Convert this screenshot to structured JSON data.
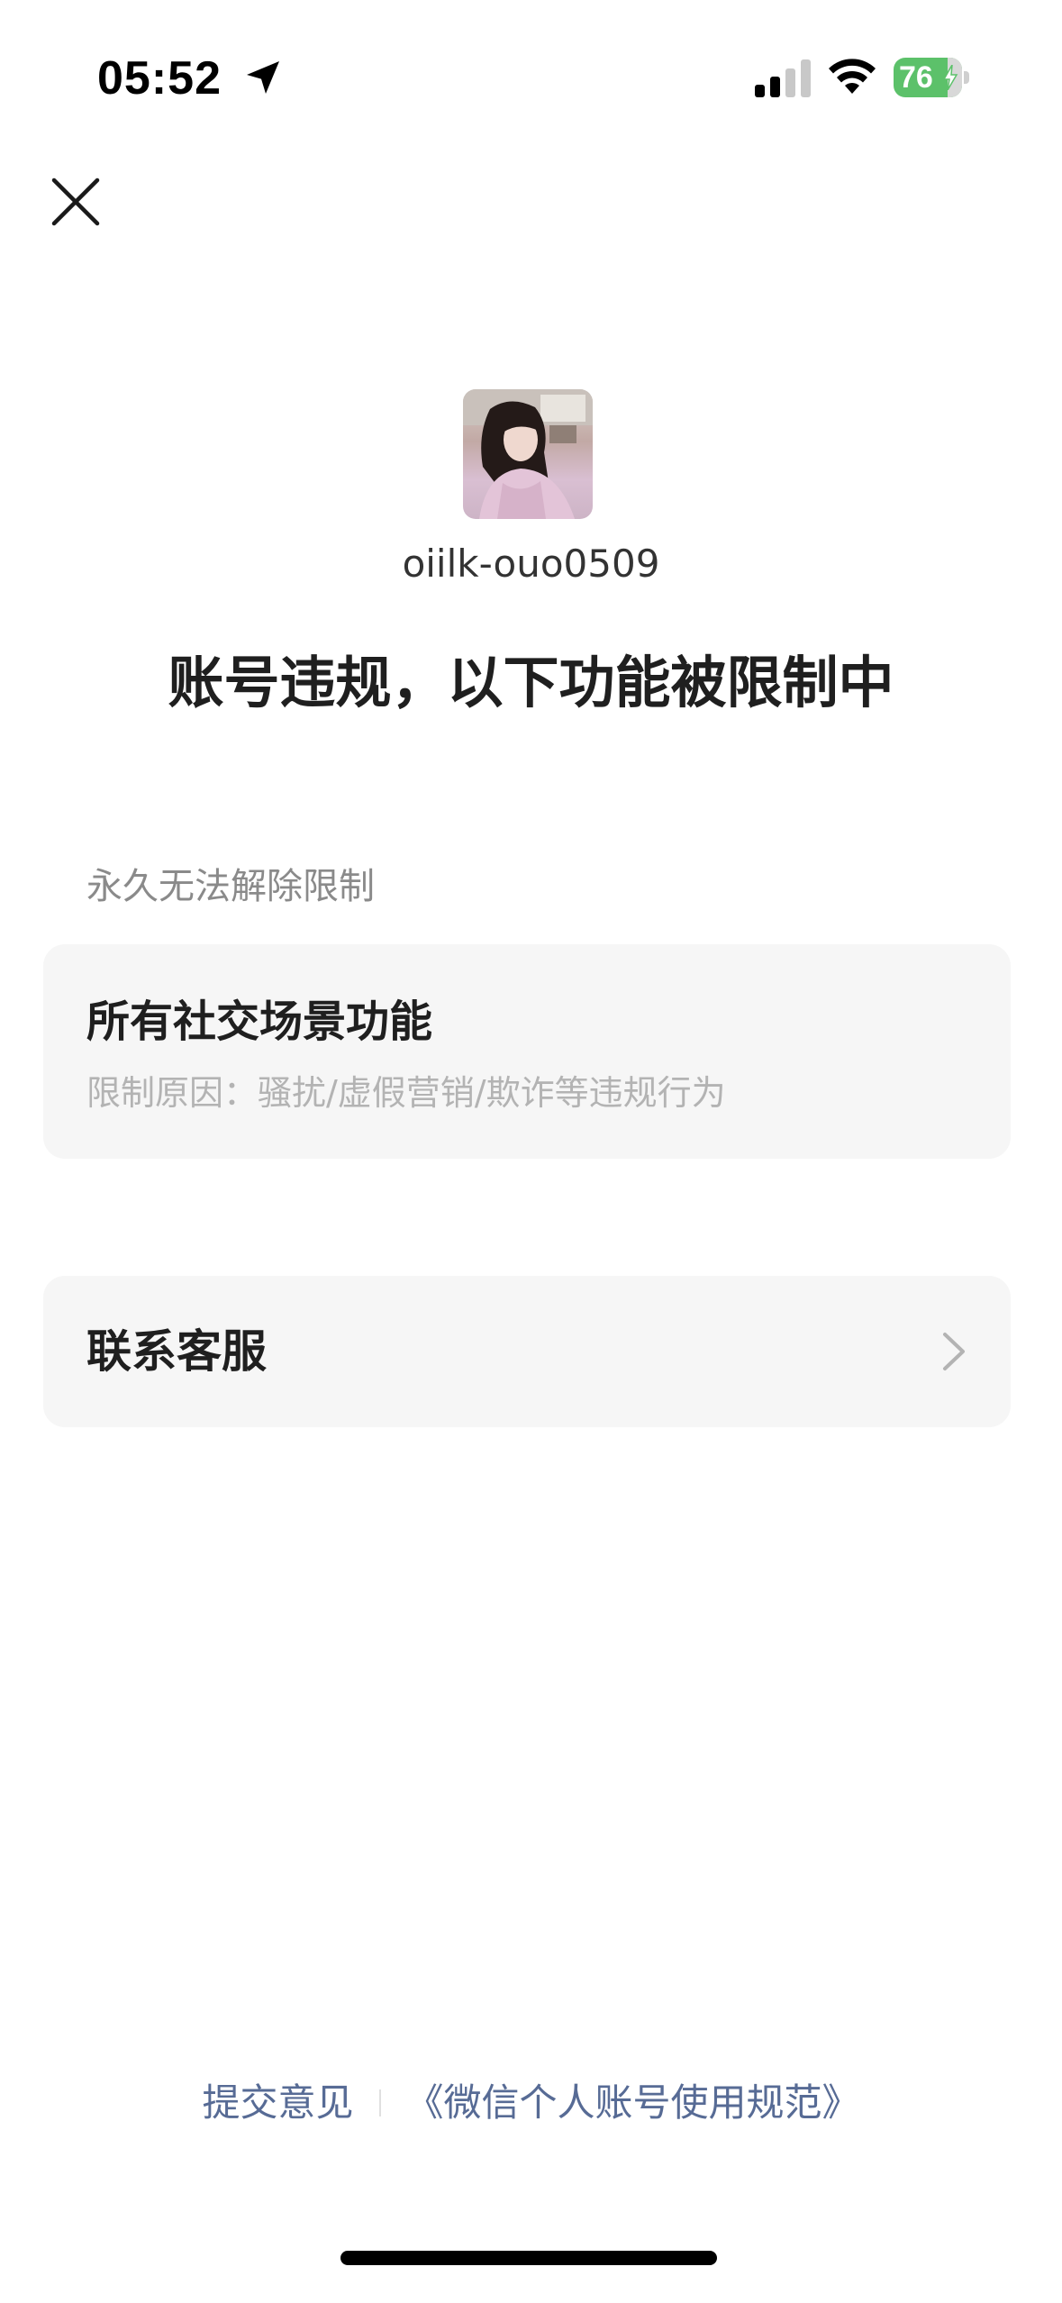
{
  "status_bar": {
    "time": "05:52",
    "battery_level": "76",
    "icons": [
      "location-arrow-icon",
      "signal-icon",
      "wifi-icon",
      "battery-icon",
      "charging-bolt-icon"
    ]
  },
  "header": {
    "close_icon": "close-icon"
  },
  "profile": {
    "username": "oiilk-ouo0509"
  },
  "notice": {
    "headline": "账号违规，以下功能被限制中",
    "section_label": "永久无法解除限制",
    "restriction": {
      "title": "所有社交场景功能",
      "reason": "限制原因：骚扰/虚假营销/欺诈等违规行为"
    }
  },
  "actions": {
    "contact_support": "联系客服"
  },
  "footer": {
    "feedback_link": "提交意见",
    "policy_link": "《微信个人账号使用规范》"
  },
  "colors": {
    "link": "#576b95",
    "battery": "#5cc16a",
    "card_bg": "#f6f6f6"
  }
}
